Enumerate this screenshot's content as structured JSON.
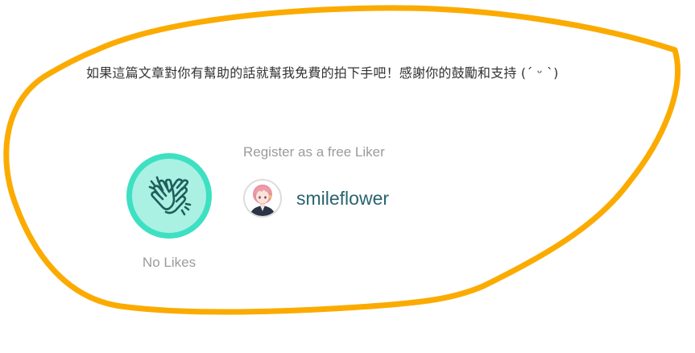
{
  "message": "如果這篇文章對你有幫助的話就幫我免費的拍下手吧！感謝你的鼓勵和支持 (ˊ ᵕ ˋ)",
  "like_widget": {
    "likes_label": "No Likes",
    "register_label": "Register as a free Liker",
    "author_name": "smileflower"
  },
  "icons": {
    "like": "clap-hands-icon",
    "avatar": "pink-haired-character-avatar"
  },
  "colors": {
    "annotation": "#fbab00",
    "like_ring": "#3ee0c2",
    "like_fill": "#aaf1e4",
    "like_icon": "#1f5e5a",
    "muted_text": "#9b9b9b",
    "author_text": "#28646e"
  }
}
